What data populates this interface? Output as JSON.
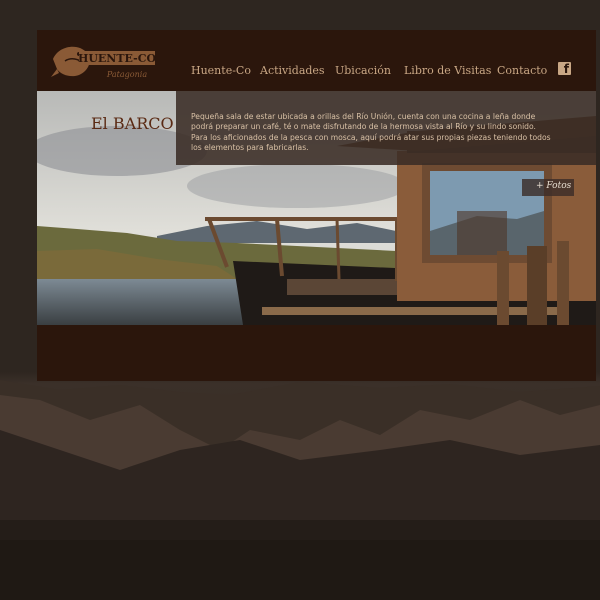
{
  "brand": {
    "logo_text": "HUENTE-CO",
    "logo_subtext": "Patagonia"
  },
  "nav": {
    "items": [
      {
        "label": "Huente-Co"
      },
      {
        "label": "Actividades"
      },
      {
        "label": "Ubicación"
      },
      {
        "label": "Libro de Visitas"
      },
      {
        "label": "Contacto"
      }
    ],
    "facebook_icon": "facebook-icon"
  },
  "hero": {
    "title": "El BARCO",
    "description": "Pequeña sala de estar ubicada a orillas del Río Unión, cuenta con una cocina a leña donde podrá preparar un café, té o mate disfrutando de la hermosa vista al Río y su lindo sonido. Para los aficionados de la pesca con mosca, aquí podrá atar sus propias piezas teniendo todos los elementos para fabricarlas.",
    "fotos_label": "+ Fotos"
  },
  "colors": {
    "panel_bg": "#2b160c",
    "nav_text": "#c9a785",
    "title": "#5a2a14",
    "info_box": "#3a2c26"
  }
}
